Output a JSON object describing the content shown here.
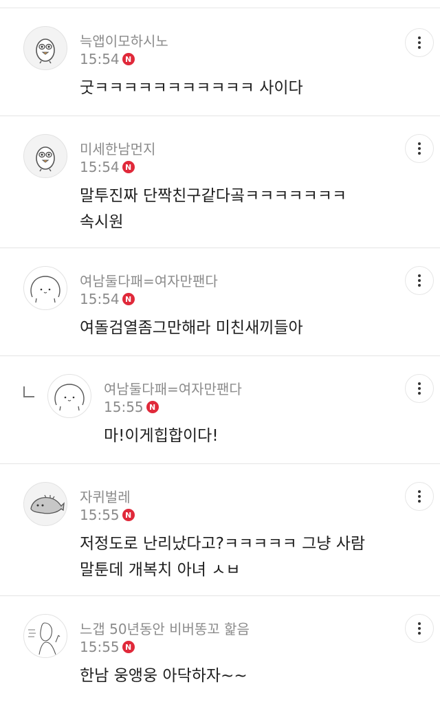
{
  "comments": [
    {
      "nickname": "늑앱이모하시노",
      "time": "15:54",
      "badge": "N",
      "text": [
        "굿ㅋㅋㅋㅋㅋㅋㅋㅋㅋㅋㅋ 사이다"
      ],
      "avatar": "bird-avatar"
    },
    {
      "nickname": "미세한남먼지",
      "time": "15:54",
      "badge": "N",
      "text": [
        "말투진짜 단짝친구같다곸ㅋㅋㅋㅋㅋㅋㅋ",
        "속시원"
      ],
      "avatar": "bird-avatar"
    },
    {
      "nickname": "여남둘다패=여자만팬다",
      "time": "15:54",
      "badge": "N",
      "text": [
        "여돌검열좀그만해라 미친새끼들아"
      ],
      "avatar": "blob-avatar"
    },
    {
      "nickname": "여남둘다패=여자만팬다",
      "time": "15:55",
      "badge": "N",
      "text": [
        "마!이게힙합이다!"
      ],
      "avatar": "blob-avatar",
      "is_reply": true
    },
    {
      "nickname": "자퀴벌레",
      "time": "15:55",
      "badge": "N",
      "text": [
        "저정도로 난리났다고?ㅋㅋㅋㅋㅋ 그냥 사람",
        "말툰데 개복치 아녀 ㅅㅂ"
      ],
      "avatar": "fish-avatar"
    },
    {
      "nickname": "느갭 50년동안 비버똥꼬 핥음",
      "time": "15:55",
      "badge": "N",
      "text": [
        "한남 웅앵웅 아닥하자~~"
      ],
      "avatar": "sketch-avatar"
    }
  ],
  "colors": {
    "badge": "#e0293a",
    "meta": "#8b8b8b",
    "text": "#1e1e1e",
    "divider": "#e4e4e4"
  },
  "icons": {
    "more": "more-vertical-icon",
    "reply": "reply-arrow-icon"
  }
}
